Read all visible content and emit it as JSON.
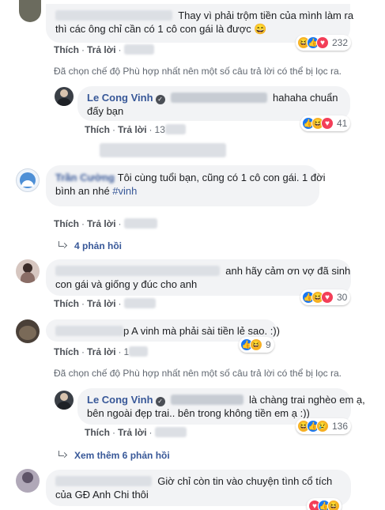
{
  "labels": {
    "like": "Thích",
    "reply": "Trả lời",
    "sep": "·"
  },
  "filter_note": "Đã chọn chế độ Phù hợp nhất nên một số câu trả lời có thể bị lọc ra.",
  "comments": [
    {
      "text_a": "Thay vì phải trộm tiền của mình làm ra",
      "text_b": "thì các ông chỉ cần có 1 cô con gái là được 😄",
      "reaction_count": "232"
    },
    {
      "author": "Le Cong Vinh",
      "text_a": "hahaha chuẩn",
      "text_b": "đấy bạn",
      "time_partial": "13",
      "reaction_count": "41"
    },
    {
      "author_blurred": "Trần Cường",
      "text_a": "Tôi cùng tuổi bạn, cũng có 1 cô con gái. 1 đời",
      "text_b": "bình an nhé ",
      "hashtag": "#vinh",
      "replies_link": "4 phản hồi"
    },
    {
      "text_a": "anh hãy cảm ơn vợ đã sinh",
      "text_b": "con gái và giống y đúc cho anh",
      "reaction_count": "30"
    },
    {
      "text_a": "p A vinh mà phải sài tiền lẻ sao. :))",
      "time_partial": "1",
      "reaction_count": "9"
    },
    {
      "author": "Le Cong Vinh",
      "text_a": "là chàng trai nghèo em ạ,",
      "text_b": "bên ngoài đẹp trai.. bên trong không tiền em ạ :))",
      "reaction_count": "136",
      "more_replies": "Xem thêm 6 phản hồi"
    },
    {
      "text_a": "Giờ chỉ còn tin vào chuyện tình cổ tích",
      "text_b": "của GĐ Anh Chi thôi"
    }
  ],
  "colors": {
    "link": "#385898",
    "bubble": "#f2f3f5",
    "meta": "#606770"
  }
}
